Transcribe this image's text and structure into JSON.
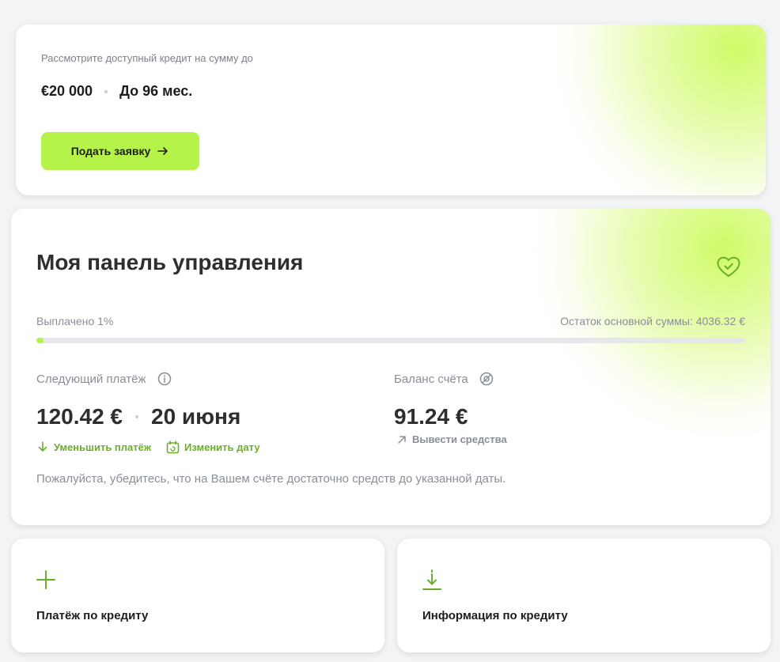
{
  "offer": {
    "subtitle": "Рассмотрите доступный кредит на сумму до",
    "amount": "€20 000",
    "term": "До 96 мес.",
    "apply_label": "Подать заявку"
  },
  "dashboard": {
    "title": "Моя панель управления",
    "paid_label": "Выплачено 1%",
    "paid_fraction": 0.01,
    "remaining_label": "Остаток основной суммы: 4036.32 €",
    "next_payment_label": "Следующий платёж",
    "next_payment_amount": "120.42 €",
    "next_payment_date": "20 июня",
    "reduce_payment_label": "Уменьшить платёж",
    "change_date_label": "Изменить дату",
    "balance_label": "Баланс счёта",
    "balance_amount": "91.24 €",
    "withdraw_label": "Вывести средства",
    "note": "Пожалуйста, убедитесь, что на Вашем счёте достаточно средств до указанной даты."
  },
  "tiles": {
    "payment_label": "Платёж по кредиту",
    "info_label": "Информация по кредиту"
  },
  "colors": {
    "accent": "#b5f34a",
    "green_text": "#6aae2a",
    "muted": "#8a8e97"
  },
  "icons": [
    "arrow-right-icon",
    "heart-check-icon",
    "info-icon",
    "eye-off-icon",
    "arrow-down-icon",
    "calendar-icon",
    "arrow-up-right-icon",
    "plus-icon",
    "download-icon"
  ]
}
